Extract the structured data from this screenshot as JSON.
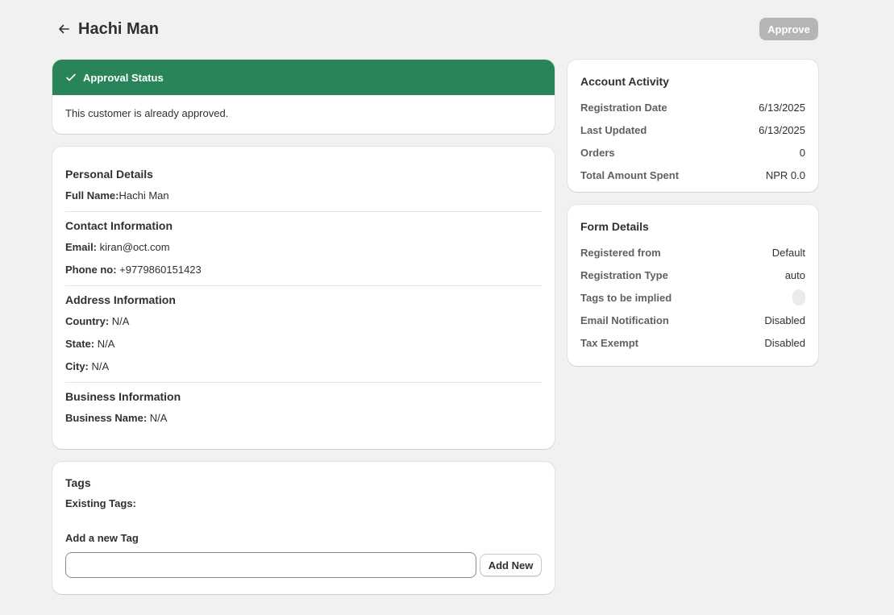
{
  "header": {
    "title": "Hachi Man",
    "approve_label": "Approve"
  },
  "approval": {
    "title": "Approval Status",
    "message": "This customer is already approved.",
    "status_color": "#29845a"
  },
  "personal": {
    "title": "Personal Details",
    "full_name_label": "Full Name:",
    "full_name": "Hachi Man"
  },
  "contact": {
    "title": "Contact Information",
    "email_label": "Email:",
    "email": "kiran@oct.com",
    "phone_label": "Phone no:",
    "phone": "+9779860151423"
  },
  "address": {
    "title": "Address Information",
    "country_label": "Country:",
    "country": "N/A",
    "state_label": "State:",
    "state": "N/A",
    "city_label": "City:",
    "city": "N/A"
  },
  "business": {
    "title": "Business Information",
    "name_label": "Business Name:",
    "name": "N/A"
  },
  "tags": {
    "title": "Tags",
    "existing_label": "Existing Tags:",
    "add_label": "Add a new Tag",
    "input_value": "",
    "add_button": "Add New"
  },
  "activity": {
    "title": "Account Activity",
    "rows": [
      {
        "label": "Registration Date",
        "value": "6/13/2025"
      },
      {
        "label": "Last Updated",
        "value": "6/13/2025"
      },
      {
        "label": "Orders",
        "value": "0"
      },
      {
        "label": "Total Amount Spent",
        "value": "NPR 0.0"
      }
    ]
  },
  "form": {
    "title": "Form Details",
    "rows": [
      {
        "label": "Registered from",
        "value": "Default"
      },
      {
        "label": "Registration Type",
        "value": "auto"
      },
      {
        "label": "Tags to be implied",
        "value": ""
      },
      {
        "label": "Email Notification",
        "value": "Disabled"
      },
      {
        "label": "Tax Exempt",
        "value": "Disabled"
      }
    ]
  },
  "icons": {
    "back": "arrow-left-icon",
    "check": "checkmark-icon"
  }
}
